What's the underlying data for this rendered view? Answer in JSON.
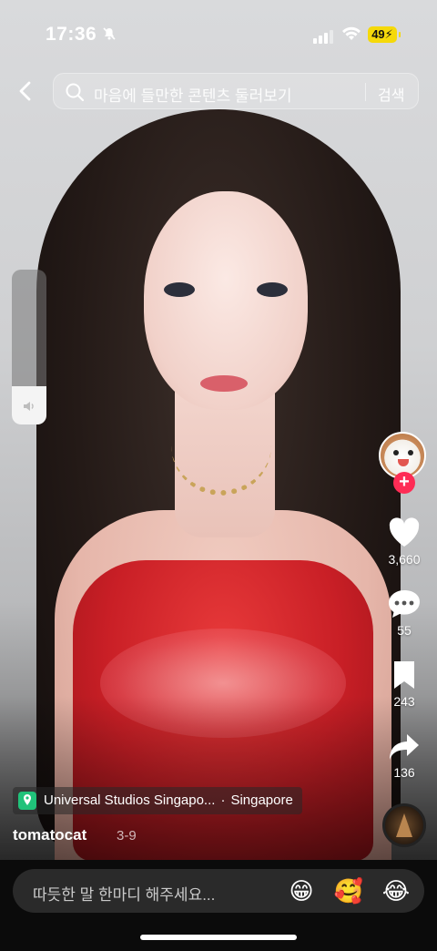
{
  "status_bar": {
    "time": "17:36",
    "battery": "49"
  },
  "header": {
    "search_placeholder": "마음에 들만한 콘텐츠 둘러보기",
    "search_button": "검색"
  },
  "volume": {
    "level": 0.25
  },
  "actions": {
    "likes": "3,660",
    "comments": "55",
    "saves": "243",
    "shares": "136"
  },
  "video_info": {
    "location": "Universal Studios Singapo...",
    "separator": "·",
    "city": "Singapore",
    "author": "tomatocat",
    "date": "3-9"
  },
  "comment_bar": {
    "placeholder": "따듯한 말 한마디 해주세요...",
    "emojis": [
      "😁",
      "🥰",
      "😂"
    ]
  },
  "colors": {
    "accent": "#fe2c55",
    "battery": "#f5d90a",
    "location_pin": "#20c27a"
  }
}
